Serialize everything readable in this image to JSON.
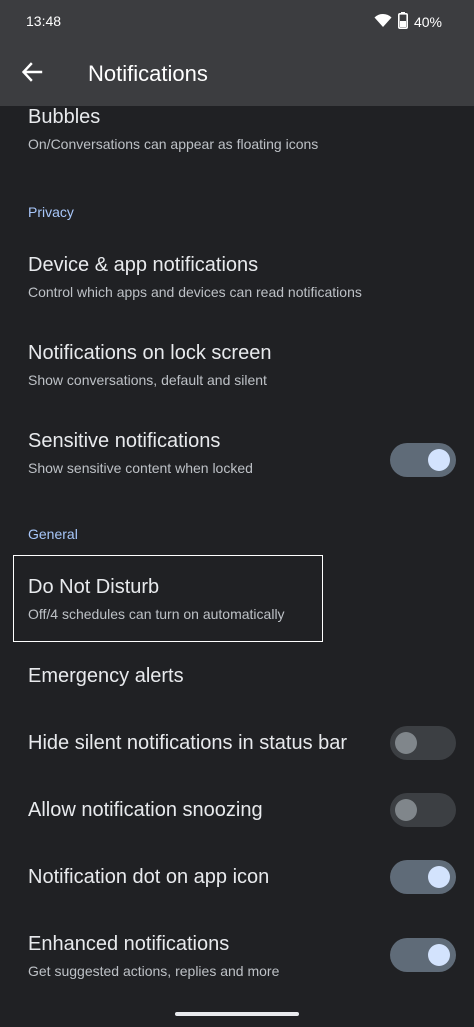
{
  "status_bar": {
    "time": "13:48",
    "battery": "40%",
    "icons": [
      "wifi-icon",
      "battery-icon"
    ]
  },
  "app_bar": {
    "title": "Notifications",
    "back_icon": "arrow-back-icon"
  },
  "items": {
    "bubbles": {
      "title": "Bubbles",
      "subtitle": "On/Conversations can appear as floating icons"
    },
    "privacy_header": "Privacy",
    "device_app": {
      "title": "Device & app notifications",
      "subtitle": "Control which apps and devices can read notifications"
    },
    "lock_screen": {
      "title": "Notifications on lock screen",
      "subtitle": "Show conversations, default and silent"
    },
    "sensitive": {
      "title": "Sensitive notifications",
      "subtitle": "Show sensitive content when locked",
      "enabled": true
    },
    "general_header": "General",
    "dnd": {
      "title": "Do Not Disturb",
      "subtitle": "Off/4 schedules can turn on automatically"
    },
    "emergency": {
      "title": "Emergency alerts"
    },
    "hide_silent": {
      "title": "Hide silent notifications in status bar",
      "enabled": false
    },
    "snoozing": {
      "title": "Allow notification snoozing",
      "enabled": false
    },
    "dot": {
      "title": "Notification dot on app icon",
      "enabled": true
    },
    "enhanced": {
      "title": "Enhanced notifications",
      "subtitle": "Get suggested actions, replies and more",
      "enabled": true
    }
  },
  "colors": {
    "background": "#202124",
    "app_bar": "#3c3d40",
    "accent": "#a8c7fa",
    "toggle_on_track": "#5f6b78",
    "toggle_on_knob": "#d3e3fd"
  }
}
